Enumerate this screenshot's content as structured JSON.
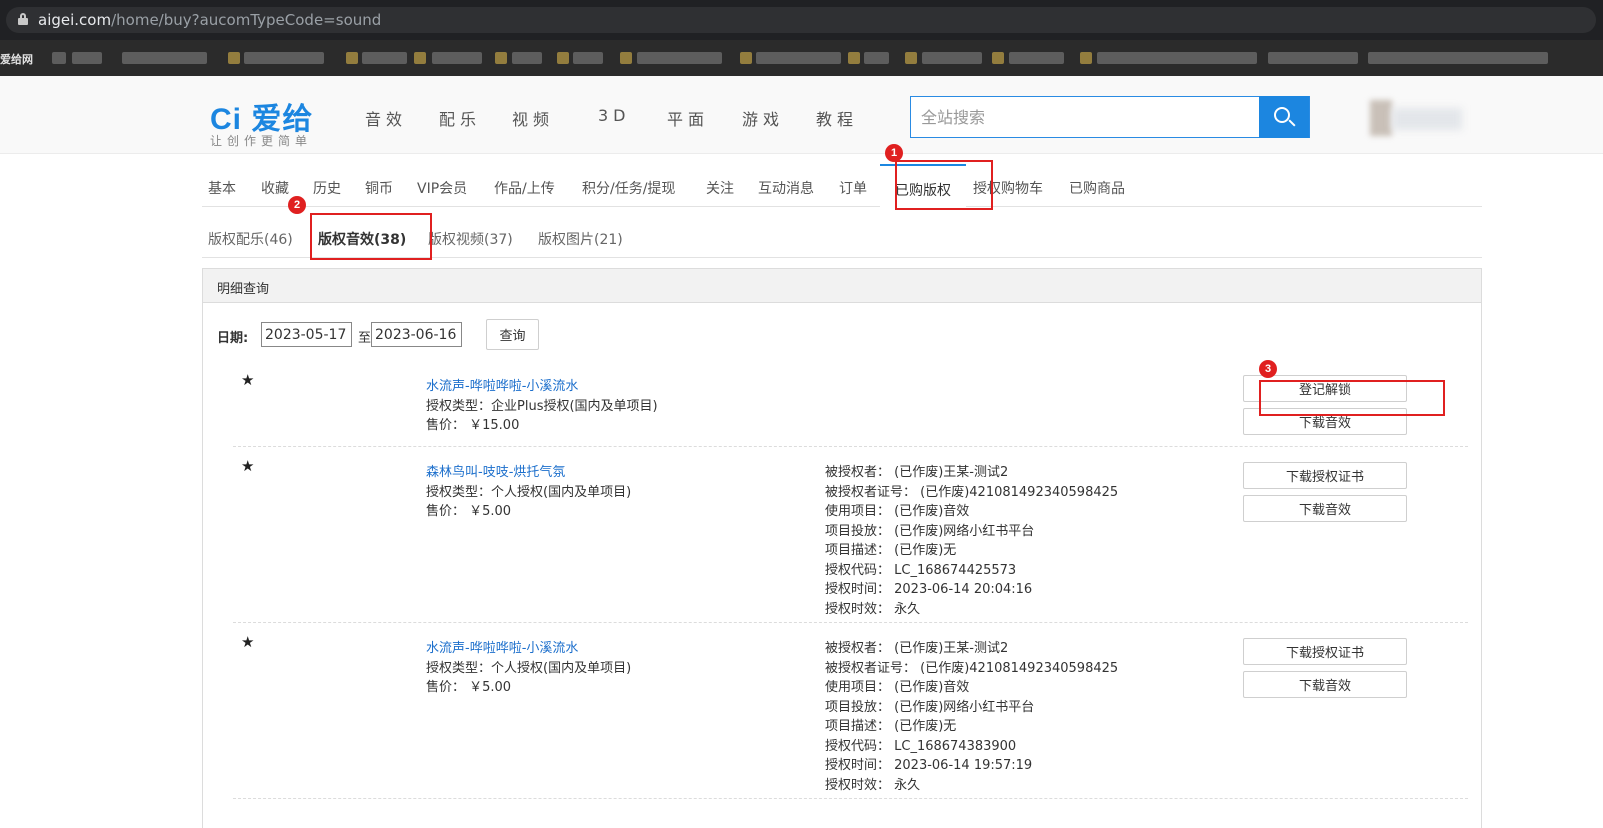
{
  "browser": {
    "url_host": "aigei.com",
    "url_path": "/home/buy?aucomTypeCode=sound",
    "bookmark_first": "爱给网"
  },
  "header": {
    "logo": "Ci 爱给",
    "slogan": "让创作更简单",
    "nav": [
      "音效",
      "配乐",
      "视频",
      "3D",
      "平面",
      "游戏",
      "教程"
    ],
    "search_placeholder": "全站搜索"
  },
  "main_tabs": [
    "基本",
    "收藏",
    "历史",
    "铜币",
    "VIP会员",
    "作品/上传",
    "积分/任务/提现",
    "关注",
    "互动消息",
    "订单",
    "已购版权",
    "授权购物车",
    "已购商品"
  ],
  "sub_tabs": [
    "版权配乐(46)",
    "版权音效(38)",
    "版权视频(37)",
    "版权图片(21)"
  ],
  "annotations": [
    "1",
    "2",
    "3"
  ],
  "panel": {
    "title": "明细查询",
    "date_label": "日期:",
    "date_from": "2023-05-17",
    "date_sep": "至",
    "date_to": "2023-06-16",
    "query_button": "查询"
  },
  "records": [
    {
      "star": "★",
      "title": "水流声-哗啦哗啦-小溪流水",
      "license_type": "授权类型：企业Plus授权(国内及单项目)",
      "price": "售价：  ￥15.00",
      "buttons": [
        "登记解锁",
        "下载音效"
      ]
    },
    {
      "star": "★",
      "title": "森林鸟叫-吱吱-烘托气氛",
      "license_type": "授权类型：个人授权(国内及单项目)",
      "price": "售价：  ￥5.00",
      "info": [
        "被授权者：  (已作废)王某-测试2",
        "被授权者证号：  (已作废)421081492340598425",
        "使用项目：  (已作废)音效",
        "项目投放：  (已作废)网络小红书平台",
        "项目描述：  (已作废)无",
        "授权代码：  LC_168674425573",
        "授权时间：  2023-06-14 20:04:16",
        "授权时效：  永久"
      ],
      "buttons": [
        "下载授权证书",
        "下载音效"
      ]
    },
    {
      "star": "★",
      "title": "水流声-哗啦哗啦-小溪流水",
      "license_type": "授权类型：个人授权(国内及单项目)",
      "price": "售价：  ￥5.00",
      "info": [
        "被授权者：  (已作废)王某-测试2",
        "被授权者证号：  (已作废)421081492340598425",
        "使用项目：  (已作废)音效",
        "项目投放：  (已作废)网络小红书平台",
        "项目描述：  (已作废)无",
        "授权代码：  LC_168674383900",
        "授权时间：  2023-06-14 19:57:19",
        "授权时效：  永久"
      ],
      "buttons": [
        "下载授权证书",
        "下载音效"
      ]
    }
  ]
}
